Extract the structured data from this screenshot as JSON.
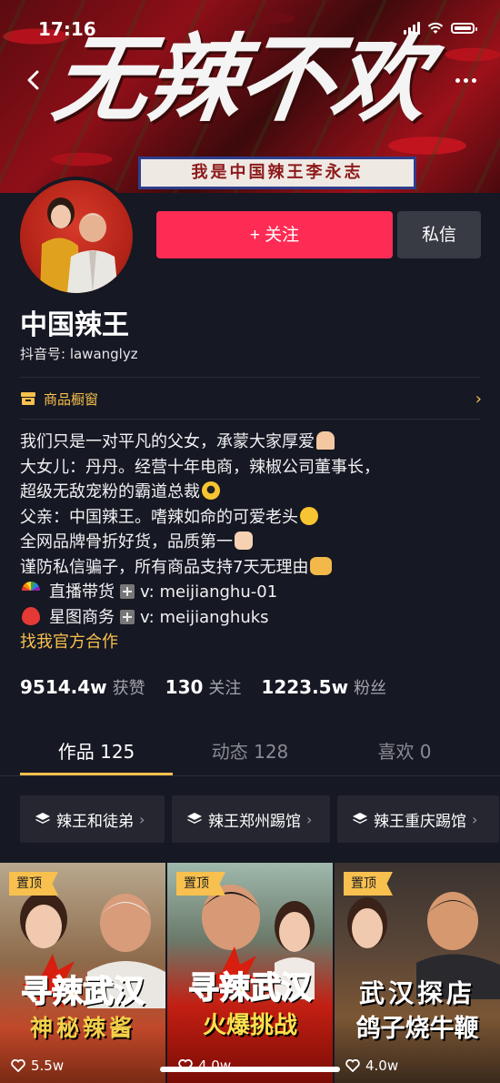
{
  "status_bar": {
    "time": "17:16"
  },
  "banner": {
    "title": "无辣不欢",
    "strip": "我是中国辣王李永志"
  },
  "profile": {
    "follow_label": "+ 关注",
    "message_label": "私信",
    "name": "中国辣王",
    "douyin_id": "抖音号: lawanglyz",
    "shop_label": "商品橱窗"
  },
  "bio": {
    "line1": "我们只是一对平凡的父女，承蒙大家厚爱",
    "line2": "大女儿：丹丹。经营十年电商，辣椒公司董事长，",
    "line3": "超级无敌宠粉的霸道总裁",
    "line4": "父亲：中国辣王。嗜辣如命的可爱老头",
    "line5": "全网品牌骨折好货，品质第一",
    "line6": "谨防私信骗子，所有商品支持7天无理由",
    "line7_a": "直播带货",
    "line7_b": "v:   meijianghu-01",
    "line8_a": "星图商务",
    "line8_b": "v:   meijianghuks",
    "link": "找我官方合作"
  },
  "stats": [
    {
      "value": "9514.4w",
      "label": "获赞"
    },
    {
      "value": "130",
      "label": "关注"
    },
    {
      "value": "1223.5w",
      "label": "粉丝"
    }
  ],
  "tabs": [
    {
      "label": "作品 125"
    },
    {
      "label": "动态 128"
    },
    {
      "label": "喜欢 0"
    }
  ],
  "collections": [
    {
      "label": "辣王和徒弟"
    },
    {
      "label": "辣王郑州踢馆"
    },
    {
      "label": "辣王重庆踢馆"
    }
  ],
  "videos": [
    {
      "pin": "置顶",
      "title1": "寻辣武汉",
      "title2": "神秘辣酱",
      "likes": "5.5w"
    },
    {
      "pin": "置顶",
      "title1": "寻辣武汉",
      "title2": "火爆挑战",
      "likes": "4.0w"
    },
    {
      "pin": "置顶",
      "title1": "武汉探店",
      "title2": "鸽子烧牛鞭",
      "likes": "4.0w"
    }
  ],
  "colors": {
    "accent": "#fe2c55",
    "gold": "#f8c04e",
    "background": "#161823"
  },
  "icons": [
    "back-icon",
    "more-icon",
    "shop-icon",
    "chevron-right-icon",
    "layers-icon",
    "heart-icon"
  ]
}
